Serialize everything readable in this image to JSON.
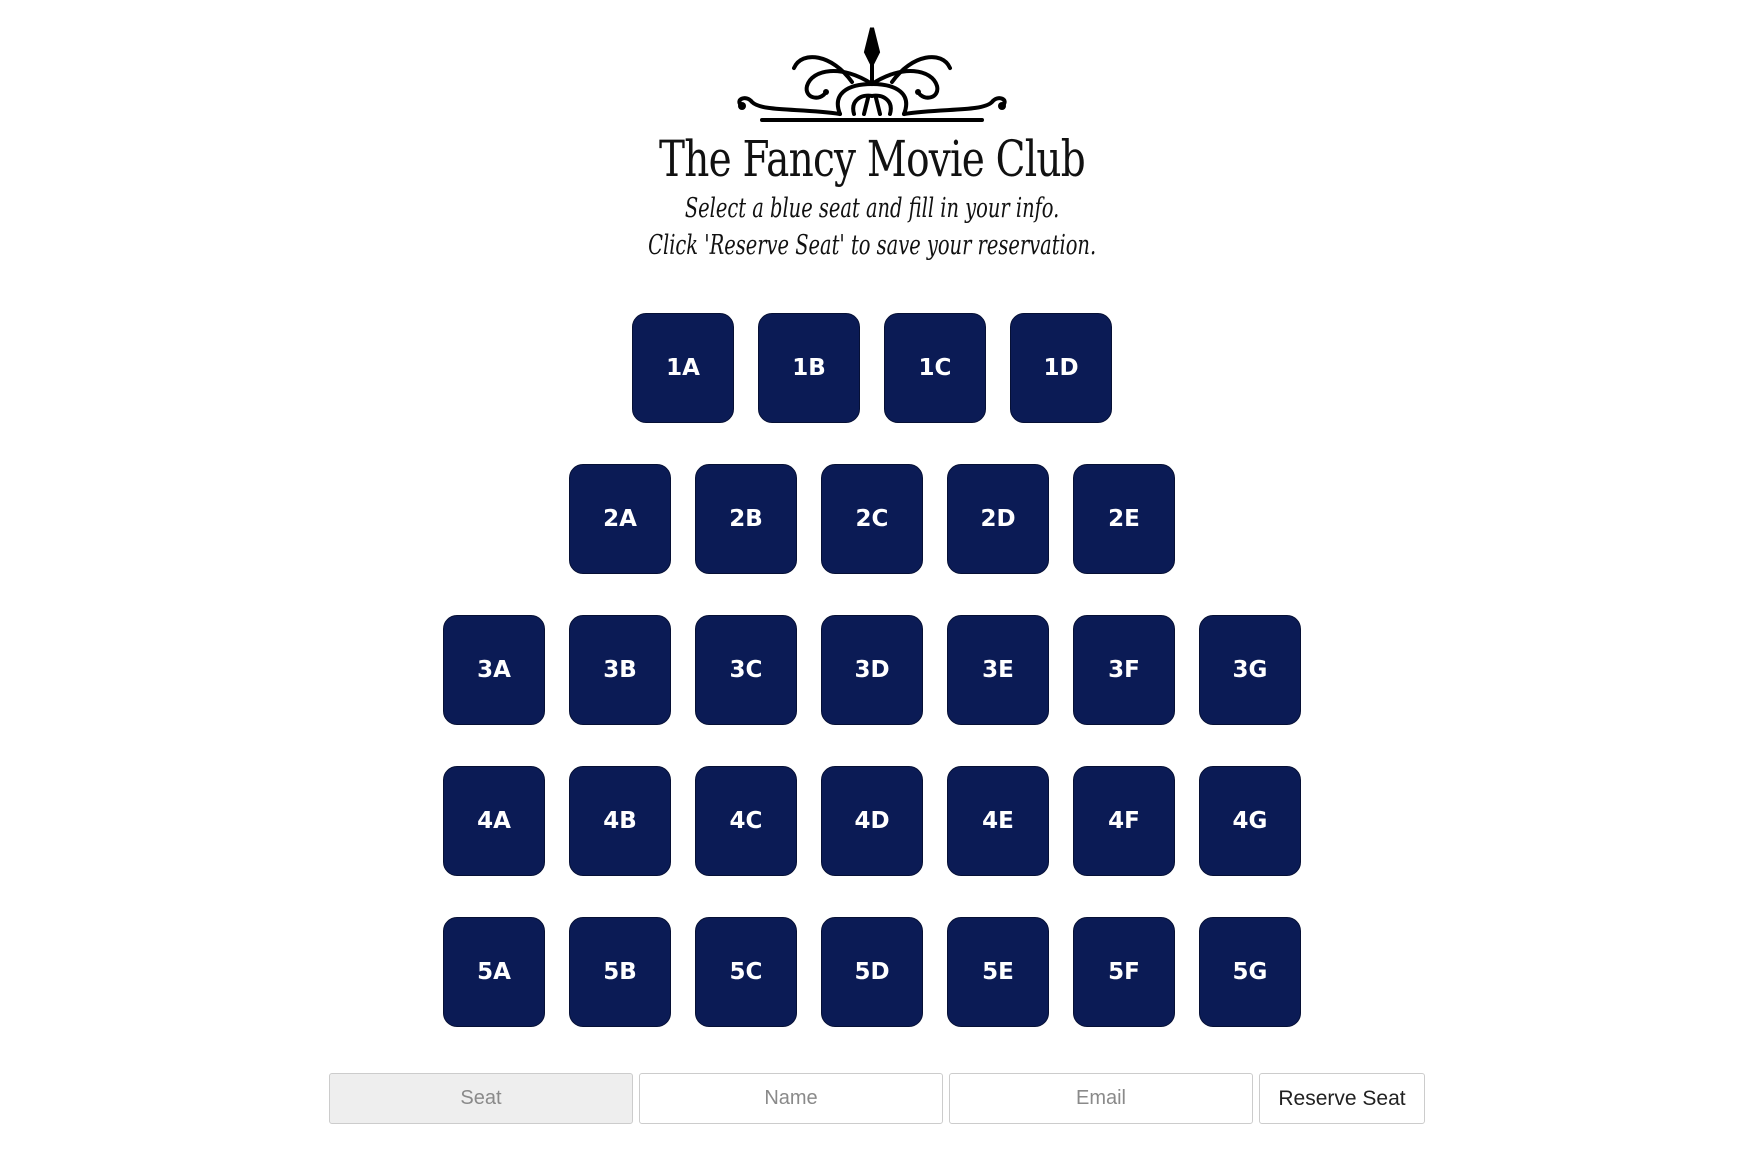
{
  "header": {
    "title": "The Fancy Movie Club",
    "instruction_line1": "Select a blue seat and fill in your info.",
    "instruction_line2": "Click 'Reserve Seat' to save your reservation."
  },
  "seats": {
    "rows": [
      [
        "1A",
        "1B",
        "1C",
        "1D"
      ],
      [
        "2A",
        "2B",
        "2C",
        "2D",
        "2E"
      ],
      [
        "3A",
        "3B",
        "3C",
        "3D",
        "3E",
        "3F",
        "3G"
      ],
      [
        "4A",
        "4B",
        "4C",
        "4D",
        "4E",
        "4F",
        "4G"
      ],
      [
        "5A",
        "5B",
        "5C",
        "5D",
        "5E",
        "5F",
        "5G"
      ]
    ],
    "available_color": "#0b1b55"
  },
  "form": {
    "seat_placeholder": "Seat",
    "name_placeholder": "Name",
    "email_placeholder": "Email",
    "reserve_label": "Reserve Seat"
  }
}
